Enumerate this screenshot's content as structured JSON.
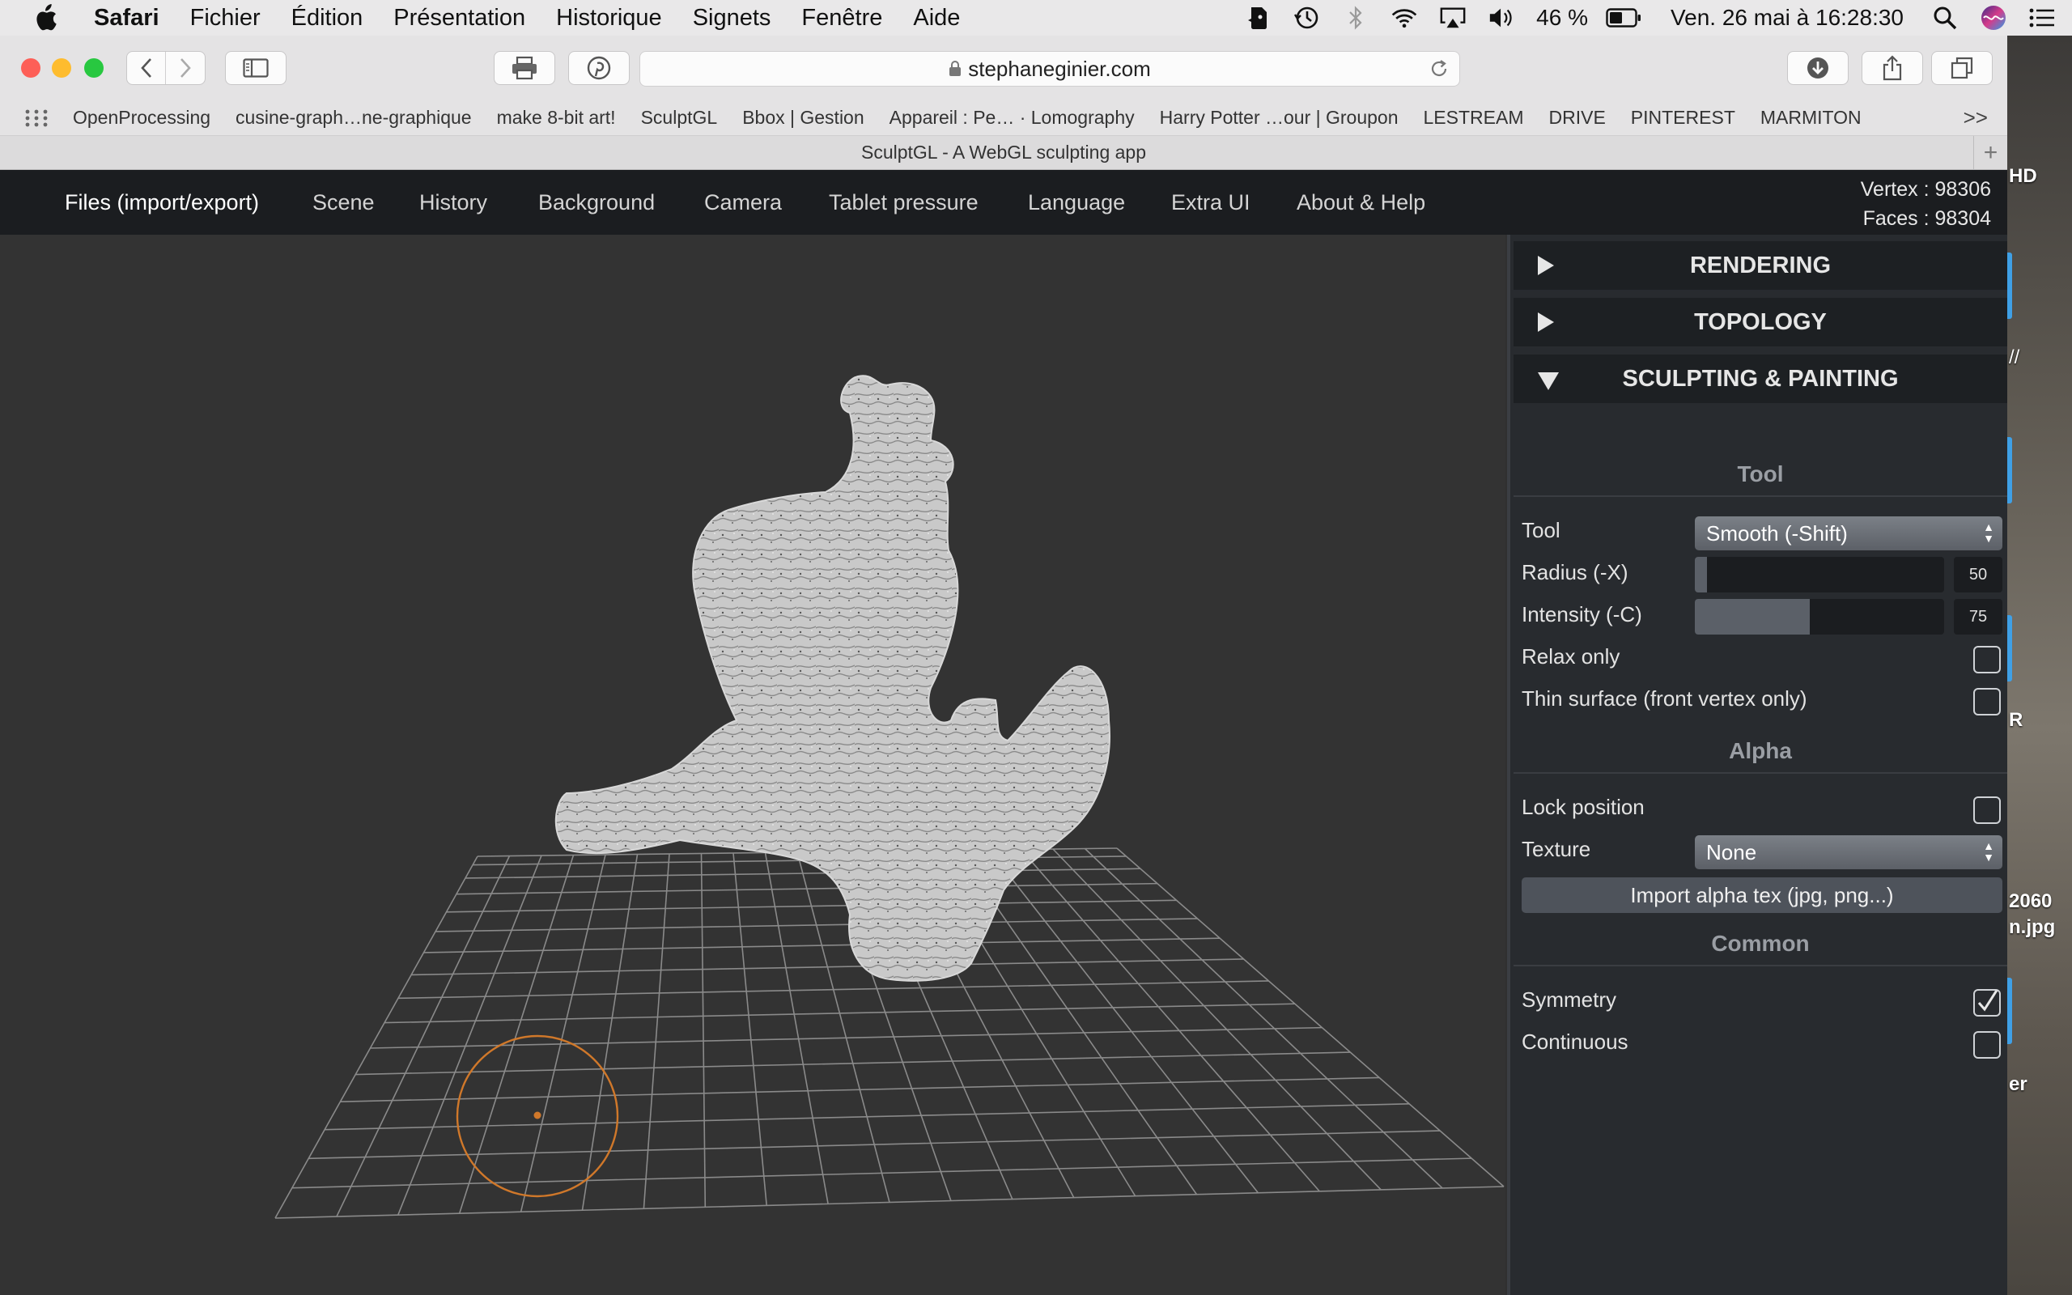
{
  "menubar": {
    "items": [
      "Safari",
      "Fichier",
      "Édition",
      "Présentation",
      "Historique",
      "Signets",
      "Fenêtre",
      "Aide"
    ],
    "battery": "46 %",
    "datetime": "Ven. 26 mai à  16:28:30"
  },
  "browser": {
    "url": "stephaneginier.com",
    "bookmarks": [
      "OpenProcessing",
      "cusine-graph…ne-graphique",
      "make 8-bit art!",
      "SculptGL",
      "Bbox | Gestion",
      "Appareil : Pe… · Lomography",
      "Harry Potter …our | Groupon",
      "LESTREAM",
      "DRIVE",
      "PINTEREST",
      "MARMITON"
    ],
    "more_bookmarks": ">>",
    "tab_title": "SculptGL - A WebGL sculpting app",
    "new_tab": "+"
  },
  "desktop": {
    "label_hd": "HD",
    "label_slash": "//",
    "label_r": "R",
    "file_line1": "2060",
    "file_line2": "n.jpg",
    "label_er": "er"
  },
  "app": {
    "nav": [
      "Files (import/export)",
      "Scene",
      "History",
      "Background",
      "Camera",
      "Tablet pressure",
      "Language",
      "Extra UI",
      "About & Help"
    ],
    "vertex": "Vertex : 98306",
    "faces": "Faces : 98304",
    "panel": {
      "rendering": "RENDERING",
      "topology": "TOPOLOGY",
      "sculpting": "SCULPTING & PAINTING",
      "tool_header": "Tool",
      "tool_label": "Tool",
      "tool_value": "Smooth (-Shift)",
      "radius_label": "Radius (-X)",
      "radius_value": "50",
      "radius_fraction": 0.05,
      "intensity_label": "Intensity (-C)",
      "intensity_value": "75",
      "intensity_fraction": 0.46,
      "relax_label": "Relax only",
      "relax_checked": false,
      "thin_label": "Thin surface (front vertex only)",
      "thin_checked": false,
      "alpha_header": "Alpha",
      "lock_label": "Lock position",
      "lock_checked": false,
      "texture_label": "Texture",
      "texture_value": "None",
      "import_button": "Import alpha tex (jpg, png...)",
      "common_header": "Common",
      "symmetry_label": "Symmetry",
      "symmetry_checked": true,
      "continuous_label": "Continuous",
      "continuous_checked": false
    }
  },
  "colors": {
    "app_bg": "#333333",
    "panel_bg": "#282b2f",
    "brush_ring": "#d0782a",
    "close": "#fd5f57",
    "minimize": "#febc2e",
    "zoom": "#28c840"
  }
}
